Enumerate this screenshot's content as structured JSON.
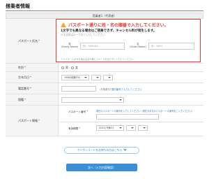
{
  "section_title": "搭乗者情報",
  "table_header": "搭乗者1（代表者）",
  "labels": {
    "passport_name": "パスポート氏名",
    "gender": "性別",
    "birthday": "生年月日",
    "phone": "電話番号",
    "nationality": "国籍",
    "passport_info": "パスポート情報",
    "passport_number": "パスポート番号",
    "expiry": "有効期限",
    "required_mark": "*"
  },
  "name_box": {
    "warning": "パスポート通りに姓・名の順番で入力してください。",
    "note_bold": "1文字でも異なる場合はご搭乗できず、キャンセル料が発生します。",
    "note_small": "※ お名前はローマ字で入力してください。",
    "surname_label": "姓",
    "surname_sub": "(Family Name)",
    "surname_placeholder": "例：YAMADA",
    "given_label": "名",
    "given_sub": "(Given Name)",
    "given_placeholder": "例：TARO",
    "bottom_note": "ミドルネームがある場合は名の欄にスペースを空けずに入力してください。"
  },
  "gender": {
    "male": "男",
    "female": "女"
  },
  "birthday": {
    "value": "1980(昭和55)"
  },
  "phone": {
    "hint": "（半角数字）",
    "hint_blue": "国内番号で入力してください"
  },
  "nationality": {
    "value": ""
  },
  "passport": {
    "number_hint": "現在のパスポートの番号を入力してください（現在お手元のパスポートの番号をご入力ください）",
    "expiry_value": "2021(令和3)"
  },
  "buttons": {
    "coupon": "クーポンコードをお持ちの方はこちら",
    "next": "次へ（入力内容確認）"
  }
}
